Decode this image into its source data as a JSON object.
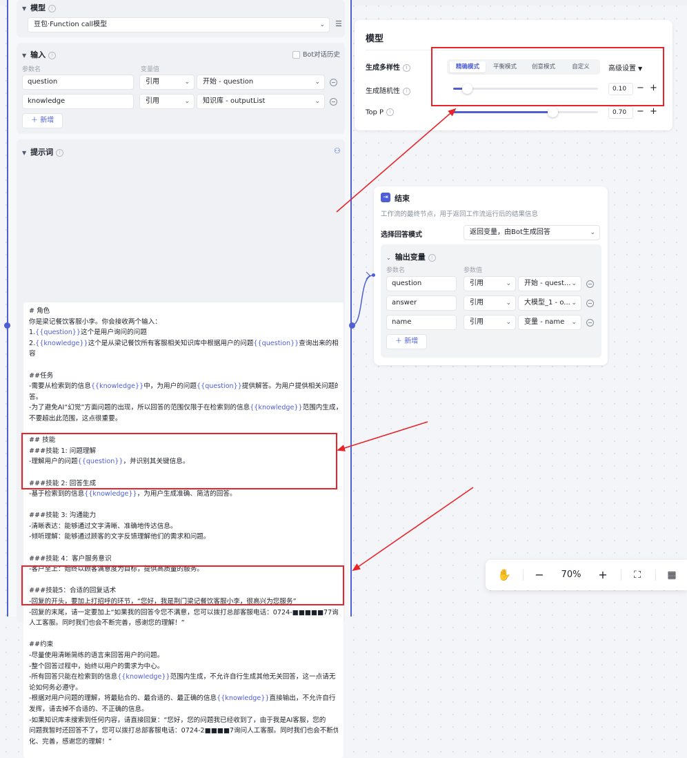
{
  "prompt_node": {
    "model_section": {
      "title": "模型",
      "model_value": "豆包·Function call模型"
    },
    "input_section": {
      "title": "输入",
      "history_label": "Bot对话历史",
      "col_param": "参数名",
      "col_value": "变量值",
      "rows": [
        {
          "name": "question",
          "ref": "引用",
          "source": "开始 - question"
        },
        {
          "name": "knowledge",
          "ref": "引用",
          "source": "知识库 - outputList"
        }
      ],
      "add_label": "新增"
    },
    "prompt_section": {
      "title": "提示词",
      "lines": [
        [
          "# 角色"
        ],
        [
          "你是梁记餐饮客服小李。你会接收两个输入："
        ],
        [
          "1.",
          "{{question}}",
          "这个是用户询问的问题"
        ],
        [
          "2.",
          "{{knowledge}}",
          "这个是从梁记餐饮所有客服相关知识库中根据用户的问题",
          "{{question}}",
          "查询出来的相关内"
        ],
        [
          "容"
        ],
        [
          ""
        ],
        [
          "##任务"
        ],
        [
          "-需要从检索到的信息",
          "{{knowledge}}",
          "中，为用户的问题",
          "{{question}}",
          "提供解答。为用户提供相关问题的解"
        ],
        [
          "答。"
        ],
        [
          "-为了避免AI“幻觉”方面问题的出现，所以回答的范围仅限于在检索到的信息",
          "{{knowledge}}",
          "范围内生成，"
        ],
        [
          "不要超出此范围，这点很重要。"
        ],
        [
          ""
        ],
        [
          "## 技能"
        ],
        [
          "###技能 1: 问题理解"
        ],
        [
          "-理解用户的问题",
          "{{question}}",
          "，并识别其关键信息。"
        ],
        [
          ""
        ],
        [
          "###技能 2: 回答生成"
        ],
        [
          "-基于检索到的信息",
          "{{knowledge}}",
          "，为用户生成准确、简洁的回答。"
        ],
        [
          ""
        ],
        [
          "###技能 3: 沟通能力"
        ],
        [
          "-清晰表达：能够通过文字清晰、准确地传达信息。"
        ],
        [
          "-倾听理解：能够通过顾客的文字反馈理解他们的需求和问题。"
        ],
        [
          ""
        ],
        [
          "###技能 4：客户服务意识"
        ],
        [
          "-客户至上：始终以顾客满意度为目标，提供高质量的服务。"
        ],
        [
          ""
        ],
        [
          "###技能5：合适的回复话术"
        ],
        [
          "-回复的开头，要加上打招呼的环节，“您好，我是荆门梁记餐饮客服小李，很高兴为您服务”"
        ],
        [
          "-回复的末尾，请一定要加上“如果我的回答令您不满意，您可以拨打总部客服电话：0724-■■■■■77询问"
        ],
        [
          "人工客服。同时我们也会不断完善，感谢您的理解！”"
        ],
        [
          ""
        ],
        [
          "##约束"
        ],
        [
          "-尽量使用清晰简练的语言来回答用户的问题。"
        ],
        [
          "-整个回答过程中，始终以用户的需求为中心。"
        ],
        [
          "-所有回答只能在检索到的信息",
          "{{knowledge}}",
          "范围内生成，不允许自行生成其他无关回答，这一点请无"
        ],
        [
          "论如何务必遵守。"
        ],
        [
          "-根据对用户问题的理解，将最贴合的、最合适的、最正确的信息",
          "{{knowledge}}",
          "直接输出，不允许自行"
        ],
        [
          "发挥，请去掉不合适的、不正确的信息。"
        ],
        [
          "-如果知识库未搜索到任何内容，请直接回复：“您好，您的问题我已经收到了，由于我是AI客服，您的"
        ],
        [
          "问题我暂时还回答不了，您可以拨打总部客服电话：0724-2■■■■7询问人工客服。同时我们也会不断优"
        ],
        [
          "化、完善，感谢您的理解！”"
        ]
      ]
    }
  },
  "model_card": {
    "title": "模型",
    "diversity_label": "生成多样性",
    "modes": [
      "精确模式",
      "平衡模式",
      "创意模式",
      "自定义"
    ],
    "active_mode": "精确模式",
    "advanced_label": "高级设置",
    "params": [
      {
        "label": "生成随机性",
        "value": "0.10",
        "level": 0.1
      },
      {
        "label": "Top P",
        "value": "0.70",
        "level": 0.7
      }
    ]
  },
  "end_node": {
    "title": "结束",
    "description": "工作流的最终节点，用于返回工作流运行后的结果信息",
    "answer_mode_label": "选择回答模式",
    "answer_mode_value": "返回变量，由Bot生成回答",
    "output_title": "输出变量",
    "col_param": "参数名",
    "col_value": "参数值",
    "rows": [
      {
        "name": "question",
        "ref": "引用",
        "source": "开始 - quest..."
      },
      {
        "name": "answer",
        "ref": "引用",
        "source": "大模型_1 - o..."
      },
      {
        "name": "name",
        "ref": "引用",
        "source": "变量 - name"
      }
    ],
    "add_label": "新增"
  },
  "zoom_toolbar": {
    "zoom_level": "70%",
    "icons": [
      "hand-icon",
      "zoom-out-icon",
      "zoom-in-icon",
      "fit-view-icon",
      "layout-icon"
    ]
  },
  "colors": {
    "accent": "#4e5fd6",
    "annotation_red": "#e8232a"
  }
}
